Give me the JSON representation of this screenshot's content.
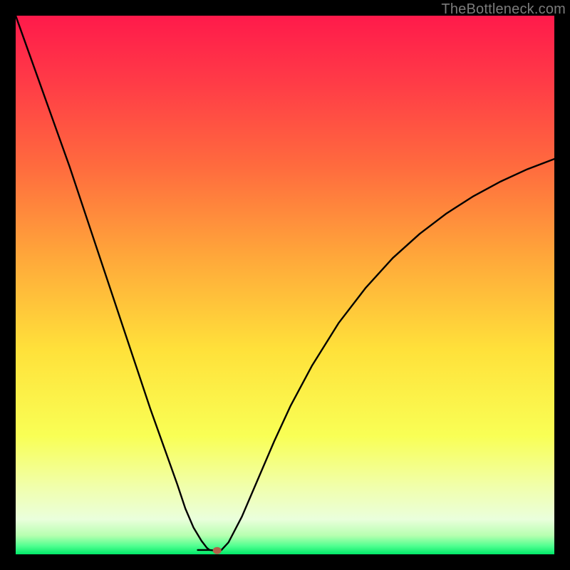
{
  "watermark": "TheBottleneck.com",
  "chart_data": {
    "type": "line",
    "title": "",
    "xlabel": "",
    "ylabel": "",
    "xlim": [
      0,
      100
    ],
    "ylim": [
      0,
      100
    ],
    "grid": false,
    "legend": false,
    "gradient_stops": [
      {
        "offset": 0.0,
        "color": "#ff1a4b"
      },
      {
        "offset": 0.12,
        "color": "#ff3a47"
      },
      {
        "offset": 0.28,
        "color": "#ff6b3e"
      },
      {
        "offset": 0.45,
        "color": "#ffa83a"
      },
      {
        "offset": 0.62,
        "color": "#ffe13a"
      },
      {
        "offset": 0.78,
        "color": "#f9ff55"
      },
      {
        "offset": 0.88,
        "color": "#f0ffb0"
      },
      {
        "offset": 0.935,
        "color": "#eaffdc"
      },
      {
        "offset": 0.965,
        "color": "#b7ffb0"
      },
      {
        "offset": 0.985,
        "color": "#4eff8f"
      },
      {
        "offset": 1.0,
        "color": "#00e868"
      }
    ],
    "series": [
      {
        "name": "curve",
        "x": [
          0.0,
          2.5,
          5.0,
          7.5,
          10.0,
          12.5,
          15.0,
          17.5,
          20.0,
          22.5,
          25.0,
          27.5,
          30.0,
          31.5,
          33.0,
          34.5,
          35.5,
          36.0,
          37.0,
          37.7,
          38.2,
          39.5,
          42.0,
          45.0,
          48.0,
          51.0,
          55.0,
          60.0,
          65.0,
          70.0,
          75.0,
          80.0,
          85.0,
          90.0,
          95.0,
          100.0
        ],
        "values": [
          100.0,
          93.0,
          86.0,
          79.0,
          72.0,
          64.5,
          57.0,
          49.5,
          42.0,
          34.5,
          27.0,
          20.0,
          13.0,
          8.5,
          5.0,
          2.5,
          1.2,
          0.8,
          0.7,
          0.7,
          0.8,
          2.2,
          7.0,
          14.0,
          21.0,
          27.5,
          35.0,
          43.0,
          49.5,
          55.0,
          59.5,
          63.3,
          66.5,
          69.2,
          71.5,
          73.4
        ]
      }
    ],
    "marker": {
      "x": 37.4,
      "y": 0.7,
      "color": "#b3604a",
      "rx": 6,
      "ry": 5
    },
    "notch": {
      "x_start": 33.8,
      "x_end": 36.0,
      "y": 0.8
    }
  }
}
